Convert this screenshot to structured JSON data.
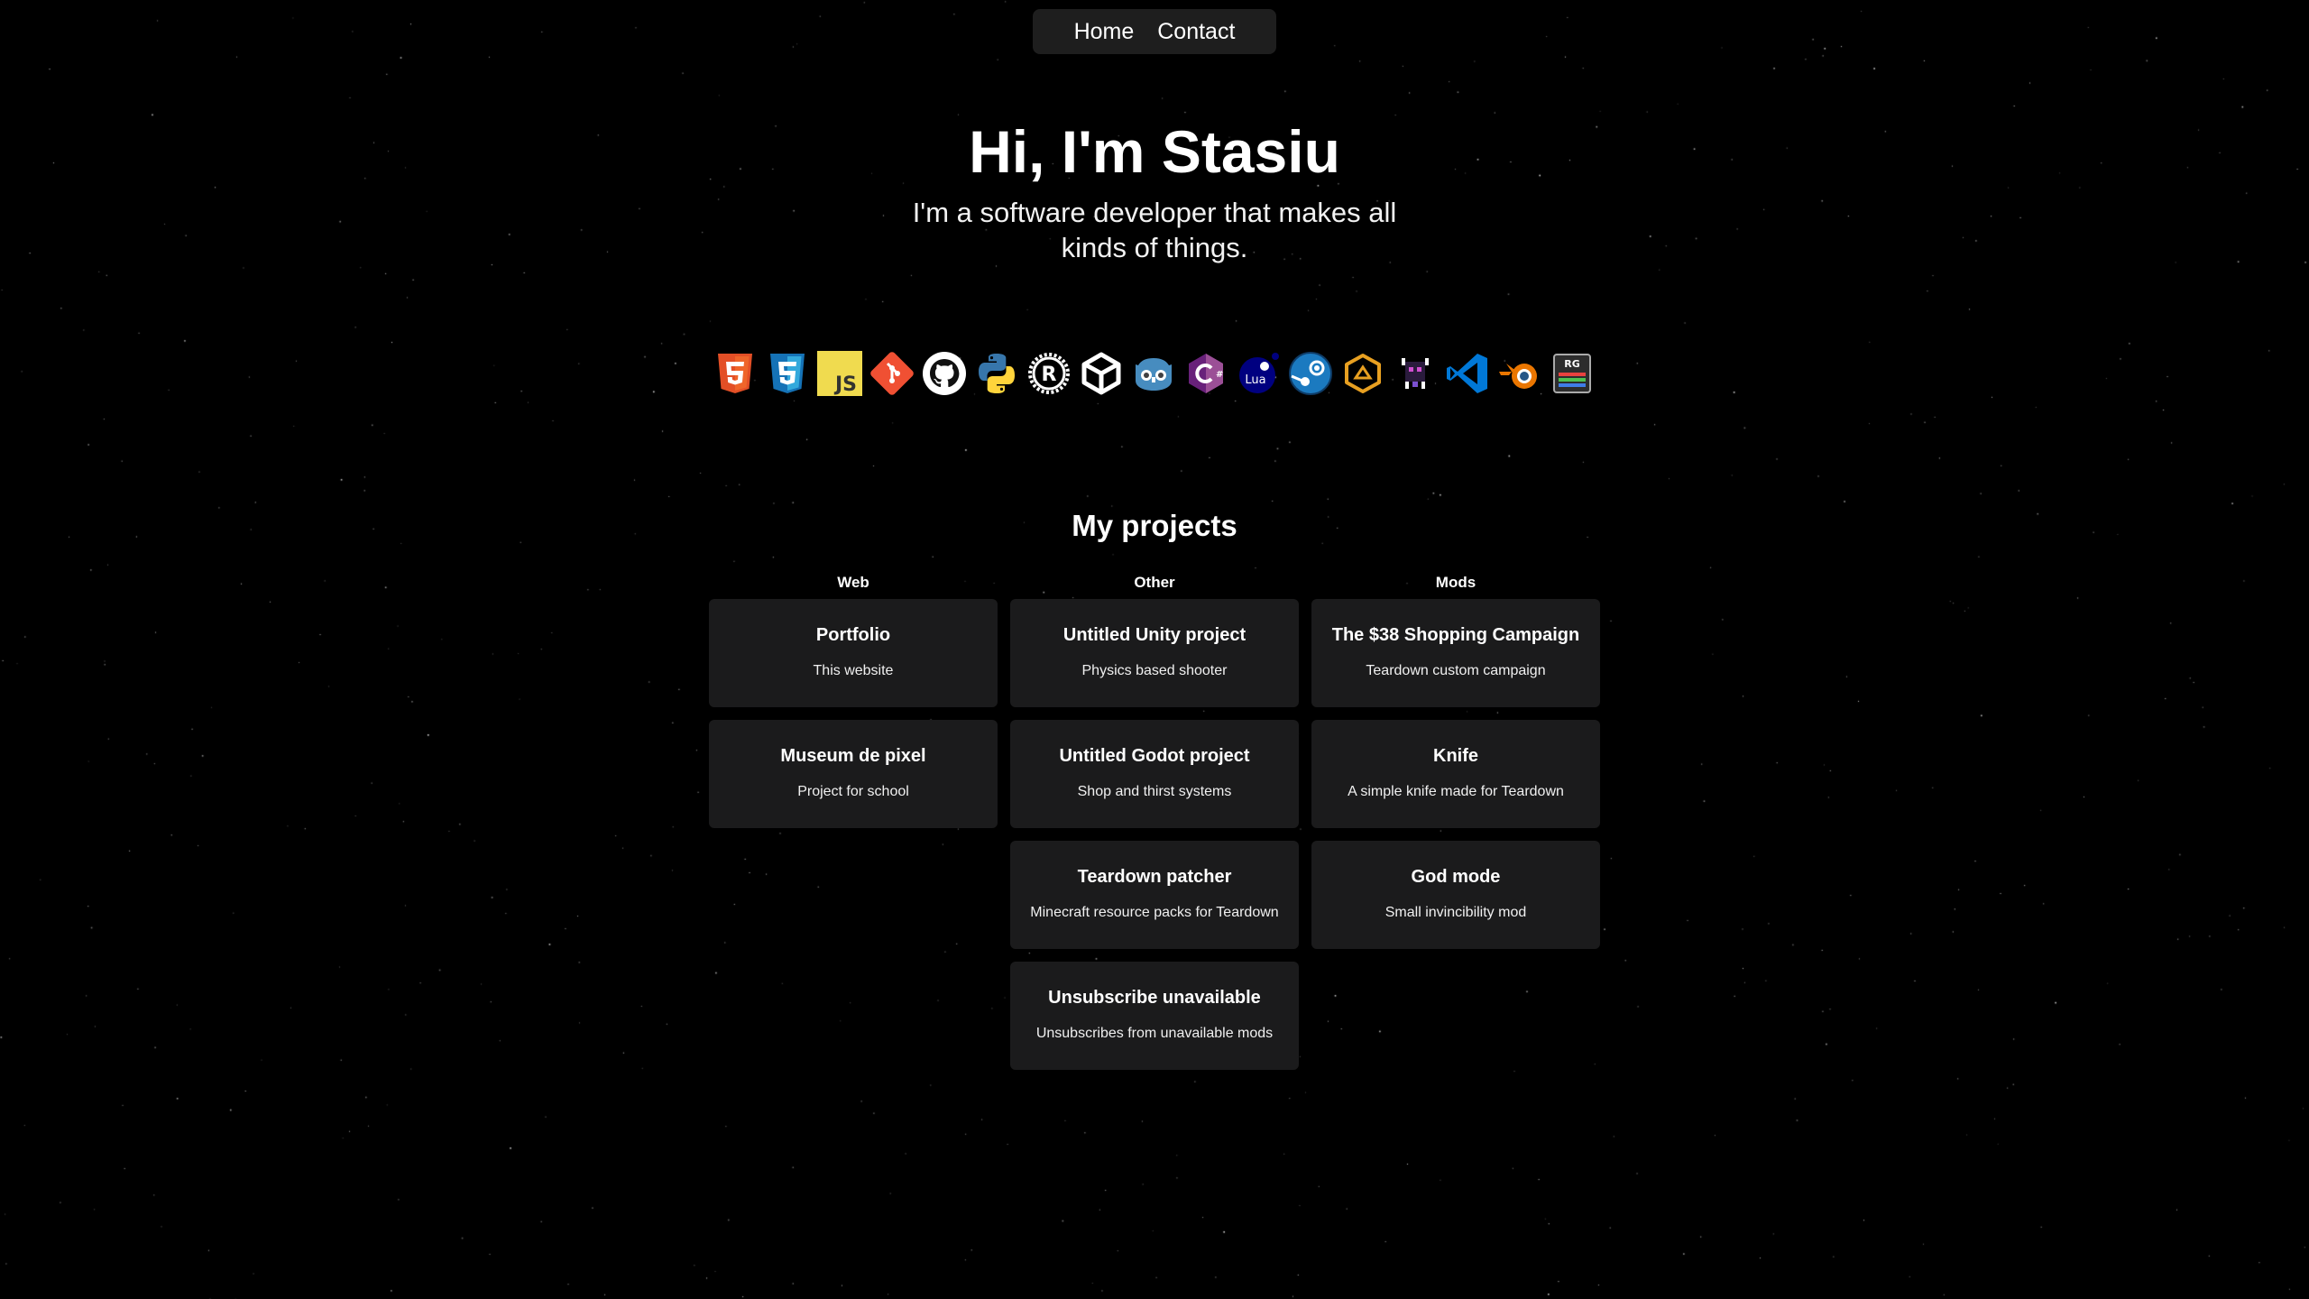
{
  "nav": {
    "items": [
      {
        "label": "Home"
      },
      {
        "label": "Contact"
      }
    ]
  },
  "hero": {
    "title": "Hi, I'm Stasiu",
    "subtitle": "I'm a software developer that makes all kinds of things."
  },
  "skills": [
    "html5-icon",
    "css3-icon",
    "javascript-icon",
    "git-icon",
    "github-icon",
    "python-icon",
    "rust-icon",
    "unity-icon",
    "godot-icon",
    "csharp-icon",
    "lua-icon",
    "steam-icon",
    "blocks-icon",
    "pixel-creature-icon",
    "vscode-icon",
    "blender-icon",
    "rgb-board-icon"
  ],
  "projects": {
    "title": "My projects",
    "columns": [
      {
        "heading": "Web",
        "cards": [
          {
            "title": "Portfolio",
            "desc": "This website"
          },
          {
            "title": "Museum de pixel",
            "desc": "Project for school"
          }
        ]
      },
      {
        "heading": "Other",
        "cards": [
          {
            "title": "Untitled Unity project",
            "desc": "Physics based shooter"
          },
          {
            "title": "Untitled Godot project",
            "desc": "Shop and thirst systems"
          },
          {
            "title": "Teardown patcher",
            "desc": "Minecraft resource packs for Teardown"
          },
          {
            "title": "Unsubscribe unavailable",
            "desc": "Unsubscribes from unavailable mods"
          }
        ]
      },
      {
        "heading": "Mods",
        "cards": [
          {
            "title": "The $38 Shopping Campaign",
            "desc": "Teardown custom campaign"
          },
          {
            "title": "Knife",
            "desc": "A simple knife made for Teardown"
          },
          {
            "title": "God mode",
            "desc": "Small invincibility mod"
          }
        ]
      }
    ]
  },
  "colors": {
    "background": "#000000",
    "card": "#1b1b1c",
    "nav": "#1e1e1e",
    "text": "#ffffff"
  }
}
